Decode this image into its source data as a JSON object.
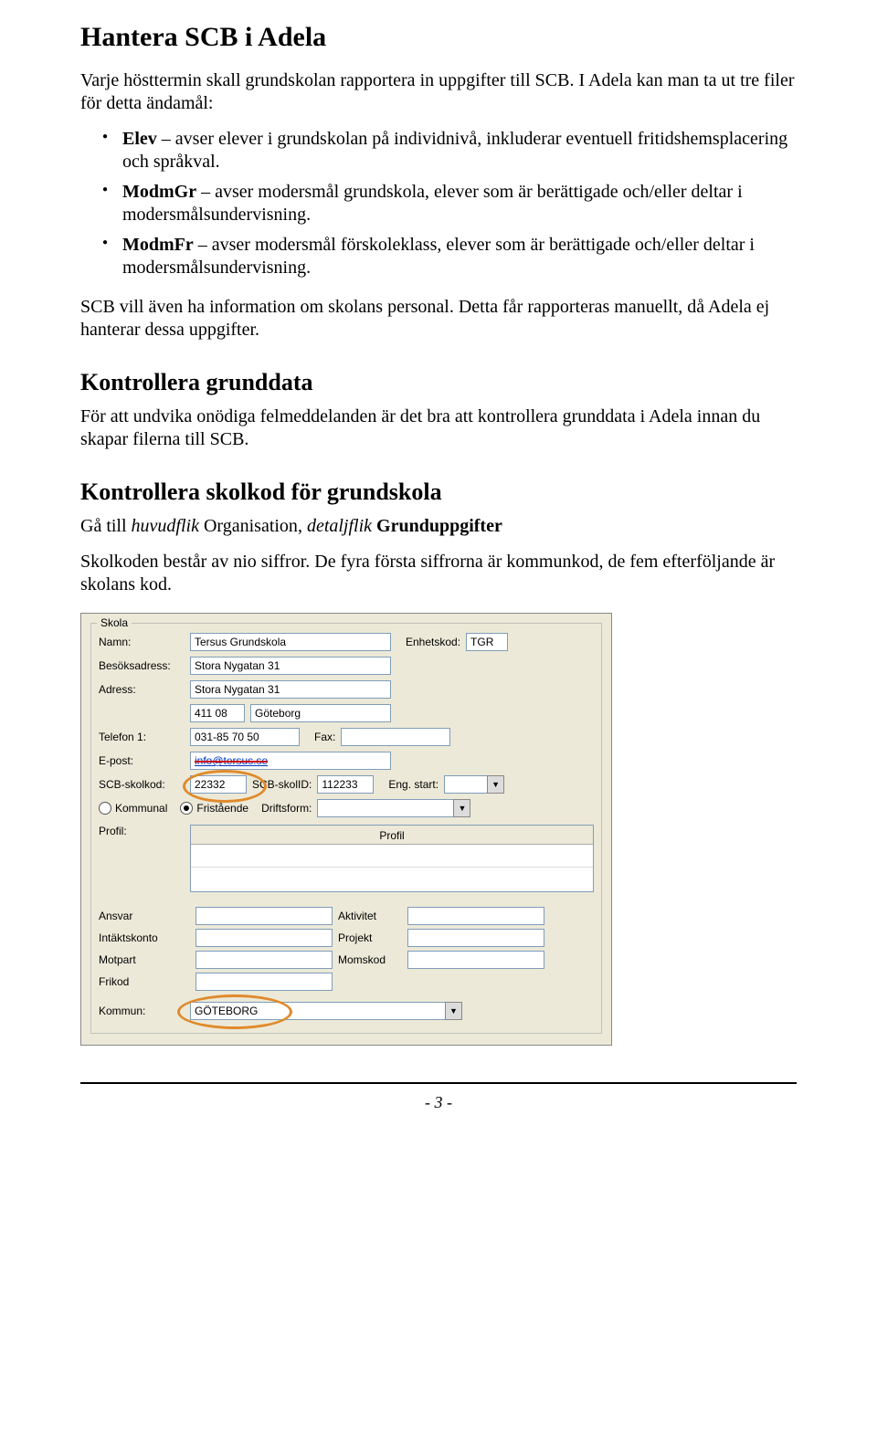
{
  "h1": "Hantera SCB i Adela",
  "p1": "Varje hösttermin skall grundskolan rapportera in uppgifter till SCB. I Adela kan man ta ut tre filer för detta ändamål:",
  "li1_b": "Elev",
  "li1_rest": " – avser elever i grundskolan på individnivå, inkluderar eventuell fritidshemsplacering och språkval.",
  "li2_b": "ModmGr",
  "li2_rest": " – avser modersmål grundskola, elever som är berättigade och/eller deltar i modersmålsundervisning.",
  "li3_b": "ModmFr",
  "li3_rest": " – avser modersmål förskoleklass, elever som är berättigade och/eller deltar i modersmålsundervisning.",
  "p2": "SCB vill även ha information om skolans personal. Detta får rapporteras manuellt, då Adela ej hanterar dessa uppgifter.",
  "h2a": "Kontrollera grunddata",
  "p3": "För att undvika onödiga felmeddelanden är det bra att kontrollera grunddata i Adela innan du skapar filerna till SCB.",
  "h2b": "Kontrollera skolkod för grundskola",
  "p4_a": "Gå till ",
  "p4_i1": "huvudflik",
  "p4_b1": " Organisation",
  "p4_c": ", ",
  "p4_i2": "detaljflik",
  "p4_b2": " Grunduppgifter",
  "p5": "Skolkoden består av nio siffror. De fyra första siffrorna är kommunkod, de fem efterföljande är skolans kod.",
  "form": {
    "legend": "Skola",
    "l_namn": "Namn:",
    "v_namn": "Tersus Grundskola",
    "l_enhet": "Enhetskod:",
    "v_enhet": "TGR",
    "l_besok": "Besöksadress:",
    "v_besok": "Stora Nygatan 31",
    "l_adr": "Adress:",
    "v_adr": "Stora Nygatan 31",
    "v_postnr": "411 08",
    "v_ort": "Göteborg",
    "l_tel": "Telefon 1:",
    "v_tel": "031-85 70 50",
    "l_fax": "Fax:",
    "l_epost": "E-post:",
    "v_epost": "info@tersus.se",
    "v_epost_vis": "info@tersus.se",
    "l_scbkod": "SCB-skolkod:",
    "v_scbkod": "22332",
    "l_scbid": "SCB-skolID:",
    "v_scbid": "112233",
    "l_engstart": "Eng. start:",
    "r_kommunal": "Kommunal",
    "r_fristaende": "Fristående",
    "l_driftsform": "Driftsform:",
    "l_profil": "Profil:",
    "h_profil": "Profil",
    "l_ansvar": "Ansvar",
    "l_aktivitet": "Aktivitet",
    "l_intakt": "Intäktskonto",
    "l_projekt": "Projekt",
    "l_motpart": "Motpart",
    "l_moms": "Momskod",
    "l_frikod": "Frikod",
    "l_kommun": "Kommun:",
    "v_kommun": "GÖTEBORG"
  },
  "pagenum": "- 3 -"
}
